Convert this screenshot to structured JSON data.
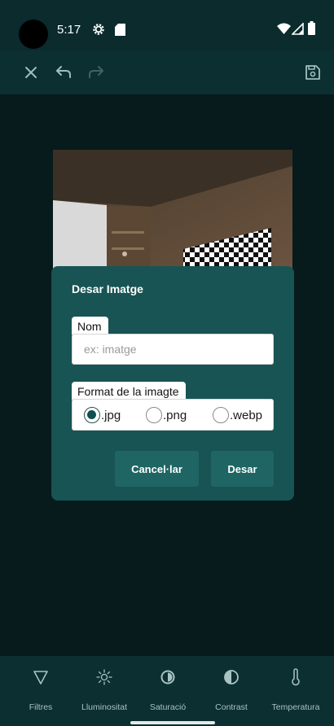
{
  "status": {
    "time": "5:17",
    "icons": [
      "settings-icon",
      "sd-card-icon",
      "wifi-icon",
      "signal-icon",
      "battery-icon"
    ]
  },
  "toolbar": {
    "icons": [
      "close-icon",
      "undo-icon",
      "redo-icon",
      "save-icon"
    ]
  },
  "dialog": {
    "title": "Desar Imatge",
    "name_label": "Nom",
    "name_placeholder": "ex: imatge",
    "name_value": "",
    "format_label": "Format de la imagte",
    "formats": [
      {
        "label": ".jpg",
        "selected": true
      },
      {
        "label": ".png",
        "selected": false
      },
      {
        "label": ".webp",
        "selected": false
      }
    ],
    "cancel_label": "Cancel·lar",
    "save_label": "Desar"
  },
  "bottom_nav": {
    "items": [
      {
        "label": "Filtres",
        "icon": "filter-icon"
      },
      {
        "label": "Lluminositat",
        "icon": "brightness-icon"
      },
      {
        "label": "Saturació",
        "icon": "saturation-icon"
      },
      {
        "label": "Contrast",
        "icon": "contrast-icon"
      },
      {
        "label": "Temperatura",
        "icon": "thermometer-icon"
      }
    ]
  },
  "colors": {
    "status_bar": "#0b2b2d",
    "toolbar": "#0c2f31",
    "background": "#071a1c",
    "dialog": "#185453",
    "dialog_button": "#1e6563",
    "nav_label": "#a8c3c2"
  }
}
